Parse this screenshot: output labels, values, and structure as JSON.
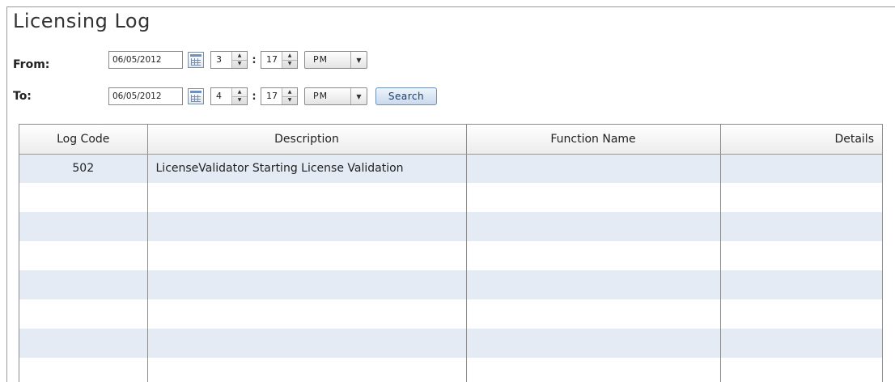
{
  "page": {
    "title": "Licensing Log"
  },
  "filters": {
    "from": {
      "label": "From:",
      "date": "06/05/2012",
      "hour": "3",
      "minute": "17",
      "separator": ":",
      "ampm": "PM"
    },
    "to": {
      "label": "To:",
      "date": "06/05/2012",
      "hour": "4",
      "minute": "17",
      "separator": ":",
      "ampm": "PM"
    },
    "search_label": "Search"
  },
  "icons": {
    "calendar": "calendar-icon",
    "spin_up": "▲",
    "spin_down": "▼",
    "dropdown": "▼"
  },
  "colors": {
    "row_stripe": "#e4ebf5",
    "button_border": "#6f8fb5"
  },
  "table": {
    "columns": [
      "Log Code",
      "Description",
      "Function Name",
      "Details"
    ],
    "rows": [
      {
        "code": "502",
        "description": "LicenseValidator Starting License Validation",
        "function": "",
        "details": ""
      },
      {
        "code": "",
        "description": "",
        "function": "",
        "details": ""
      },
      {
        "code": "",
        "description": "",
        "function": "",
        "details": ""
      },
      {
        "code": "",
        "description": "",
        "function": "",
        "details": ""
      },
      {
        "code": "",
        "description": "",
        "function": "",
        "details": ""
      },
      {
        "code": "",
        "description": "",
        "function": "",
        "details": ""
      },
      {
        "code": "",
        "description": "",
        "function": "",
        "details": ""
      },
      {
        "code": "",
        "description": "",
        "function": "",
        "details": ""
      }
    ]
  }
}
